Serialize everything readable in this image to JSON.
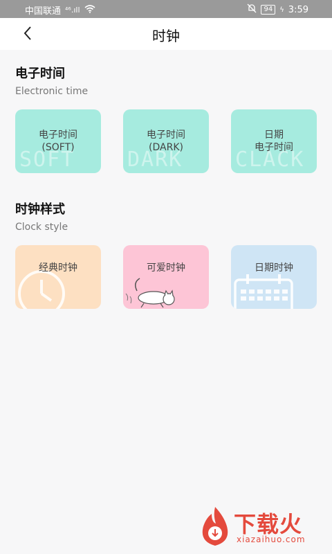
{
  "status": {
    "carrier": "中国联通",
    "signal": "⁴⁶.ıll",
    "battery": "94",
    "time": "3:59"
  },
  "header": {
    "title": "时钟"
  },
  "electronic": {
    "title": "电子时间",
    "subtitle": "Electronic time",
    "cards": [
      {
        "line1": "电子时间",
        "line2": "(SOFT)",
        "ghost": "SOFT"
      },
      {
        "line1": "电子时间",
        "line2": "(DARK)",
        "ghost": "DARK"
      },
      {
        "line1": "日期",
        "line2": "电子时间",
        "ghost": "CLACK"
      }
    ]
  },
  "clock": {
    "title": "时钟样式",
    "subtitle": "Clock style",
    "cards": [
      {
        "label": "经典时钟"
      },
      {
        "label": "可爱时钟"
      },
      {
        "label": "日期时钟"
      }
    ]
  },
  "watermark": {
    "text": "下载火",
    "sub": "xiazaihuo.com"
  }
}
